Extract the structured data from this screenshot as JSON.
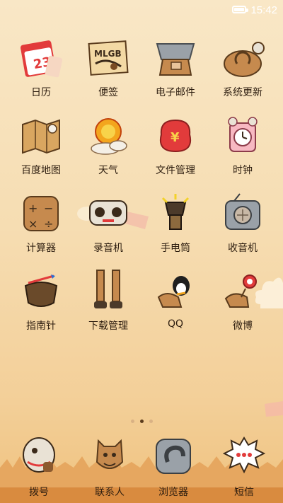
{
  "status_bar": {
    "time": "15:42",
    "battery_level": 0.85
  },
  "apps": [
    {
      "label": "日历",
      "icon": "calendar-icon",
      "icon_text": "23"
    },
    {
      "label": "便签",
      "icon": "notes-icon",
      "icon_text": "MLGB"
    },
    {
      "label": "电子邮件",
      "icon": "email-icon"
    },
    {
      "label": "系统更新",
      "icon": "system-update-icon"
    },
    {
      "label": "百度地图",
      "icon": "map-icon"
    },
    {
      "label": "天气",
      "icon": "weather-icon"
    },
    {
      "label": "文件管理",
      "icon": "file-manager-icon",
      "icon_text": "¥"
    },
    {
      "label": "时钟",
      "icon": "clock-icon"
    },
    {
      "label": "计算器",
      "icon": "calculator-icon"
    },
    {
      "label": "录音机",
      "icon": "recorder-icon"
    },
    {
      "label": "手电筒",
      "icon": "flashlight-icon"
    },
    {
      "label": "收音机",
      "icon": "radio-icon"
    },
    {
      "label": "指南针",
      "icon": "compass-icon"
    },
    {
      "label": "下载管理",
      "icon": "download-manager-icon"
    },
    {
      "label": "QQ",
      "icon": "qq-icon"
    },
    {
      "label": "微博",
      "icon": "weibo-icon"
    }
  ],
  "dock": [
    {
      "label": "拨号",
      "icon": "phone-dialer-icon"
    },
    {
      "label": "联系人",
      "icon": "contacts-icon"
    },
    {
      "label": "浏览器",
      "icon": "browser-icon"
    },
    {
      "label": "短信",
      "icon": "messages-icon"
    }
  ],
  "pages": {
    "total": 3,
    "current": 2
  }
}
